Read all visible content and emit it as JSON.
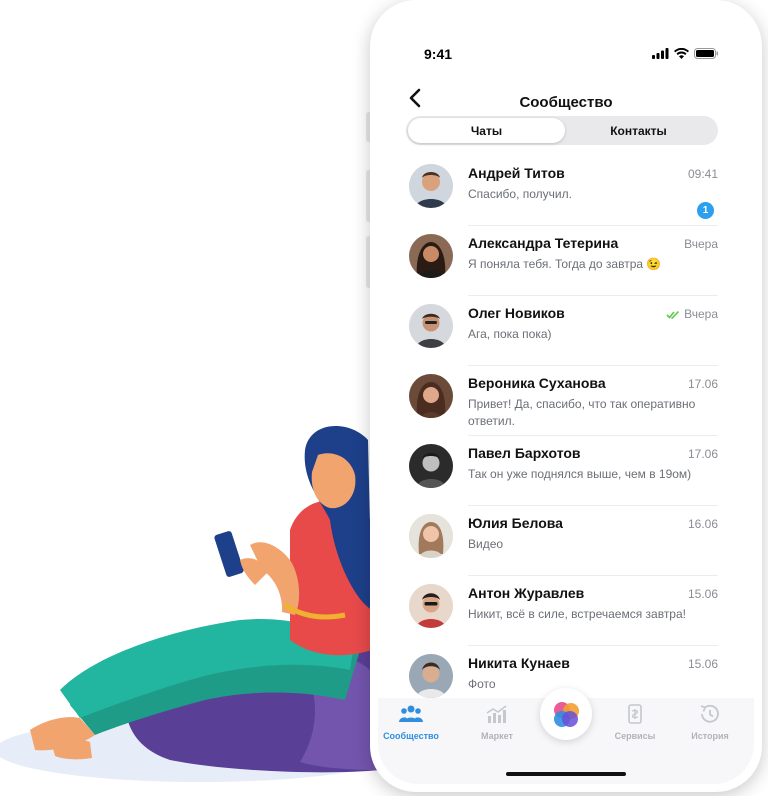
{
  "status_bar": {
    "time": "9:41"
  },
  "header": {
    "title": "Сообщество"
  },
  "segments": {
    "active": "Чаты",
    "other": "Контакты"
  },
  "chats": [
    {
      "name": "Андрей Титов",
      "message": "Спасибо, получил.",
      "date": "09:41",
      "unread": "1"
    },
    {
      "name": "Александра Тетерина",
      "message": "Я поняла тебя. Тогда до завтра 😉",
      "date": "Вчера"
    },
    {
      "name": "Олег Новиков",
      "message": "Ага, пока пока)",
      "date": "Вчера",
      "read_check": true
    },
    {
      "name": "Вероника Суханова",
      "message": "Привет! Да, спасибо, что так оперативно ответил.",
      "date": "17.06"
    },
    {
      "name": "Павел Бархотов",
      "message": "Так он уже поднялся выше, чем в 19ом)",
      "date": "17.06"
    },
    {
      "name": "Юлия Белова",
      "message": "Видео",
      "date": "16.06"
    },
    {
      "name": "Антон Журавлев",
      "message": "Никит, всё в силе, встречаемся завтра!",
      "date": "15.06"
    },
    {
      "name": "Никита Кунаев",
      "message": "Фото",
      "date": "15.06"
    }
  ],
  "tabbar": {
    "community": "Сообщество",
    "market": "Маркет",
    "services": "Сервисы",
    "history": "История"
  },
  "colors": {
    "accent": "#2f8ee0",
    "badge": "#2aa0ee",
    "check": "#5cc94e"
  }
}
